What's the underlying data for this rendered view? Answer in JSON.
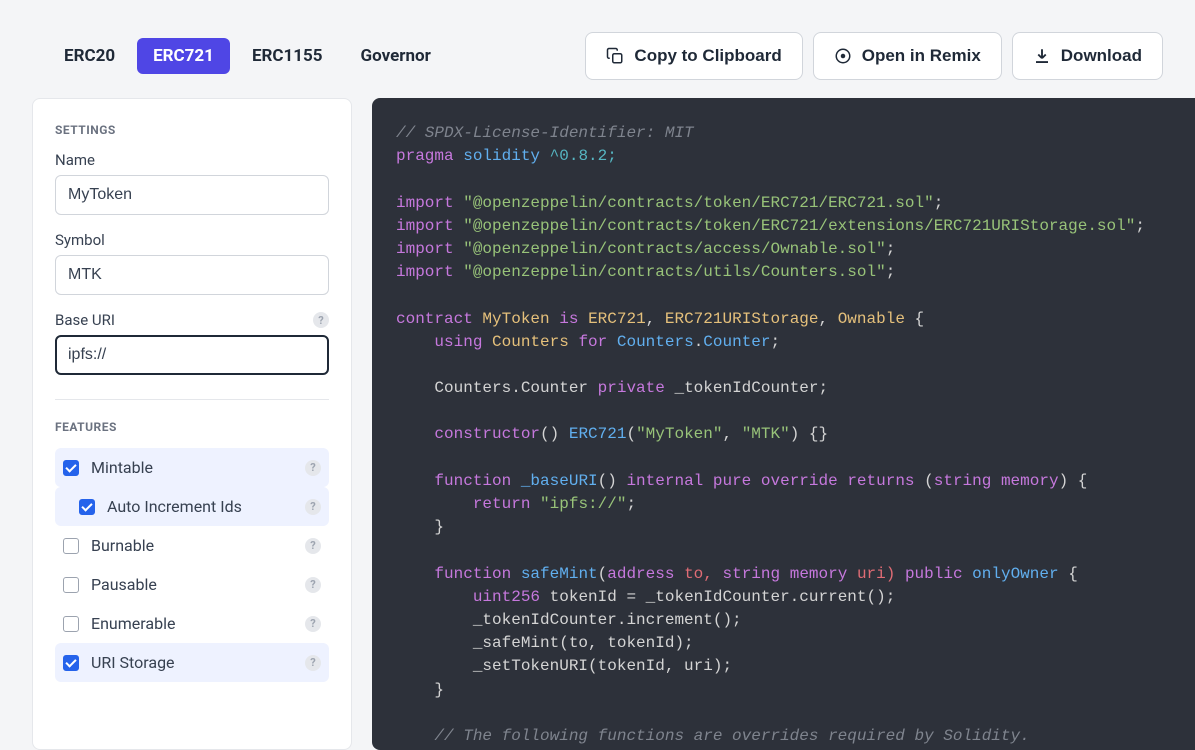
{
  "tabs": {
    "erc20": "ERC20",
    "erc721": "ERC721",
    "erc1155": "ERC1155",
    "governor": "Governor"
  },
  "actions": {
    "copy": "Copy to Clipboard",
    "remix": "Open in Remix",
    "download": "Download"
  },
  "sidebar": {
    "settings_title": "SETTINGS",
    "name_label": "Name",
    "name_value": "MyToken",
    "symbol_label": "Symbol",
    "symbol_value": "MTK",
    "baseuri_label": "Base URI",
    "baseuri_value": "ipfs://",
    "features_title": "FEATURES",
    "features": {
      "mintable": "Mintable",
      "autoincrement": "Auto Increment Ids",
      "burnable": "Burnable",
      "pausable": "Pausable",
      "enumerable": "Enumerable",
      "uristorage": "URI Storage"
    }
  },
  "code": {
    "l1": "// SPDX-License-Identifier: MIT",
    "l2a": "pragma",
    "l2b": "solidity",
    "l2c": "^0.8.2;",
    "l3a": "import",
    "l3b": "\"@openzeppelin/contracts/token/ERC721/ERC721.sol\"",
    "l4b": "\"@openzeppelin/contracts/token/ERC721/extensions/ERC721URIStorage.sol\"",
    "l5b": "\"@openzeppelin/contracts/access/Ownable.sol\"",
    "l6b": "\"@openzeppelin/contracts/utils/Counters.sol\"",
    "l7a": "contract",
    "l7b": "MyToken",
    "l7c": "is",
    "l7d": "ERC721",
    "l7e": "ERC721URIStorage",
    "l7f": "Ownable",
    "l8a": "using",
    "l8b": "Counters",
    "l8c": "for",
    "l8d": "Counters",
    "l8e": "Counter",
    "l9a": "Counters.Counter",
    "l9b": "private",
    "l9c": "_tokenIdCounter;",
    "l10a": "constructor",
    "l10b": "ERC721",
    "l10c": "\"MyToken\"",
    "l10d": "\"MTK\"",
    "l11a": "function",
    "l11b": "_baseURI",
    "l11c": "internal",
    "l11d": "pure",
    "l11e": "override",
    "l11f": "returns",
    "l11g": "string",
    "l11h": "memory",
    "l12a": "return",
    "l12b": "\"ipfs://\"",
    "l13a": "function",
    "l13b": "safeMint",
    "l13c": "address",
    "l13d": "to,",
    "l13e": "string",
    "l13f": "memory",
    "l13g": "uri)",
    "l13h": "public",
    "l13i": "onlyOwner",
    "l14a": "uint256",
    "l14b": "tokenId = _tokenIdCounter.current();",
    "l15": "_tokenIdCounter.increment();",
    "l16": "_safeMint(to, tokenId);",
    "l17": "_setTokenURI(tokenId, uri);",
    "l18": "// The following functions are overrides required by Solidity."
  }
}
